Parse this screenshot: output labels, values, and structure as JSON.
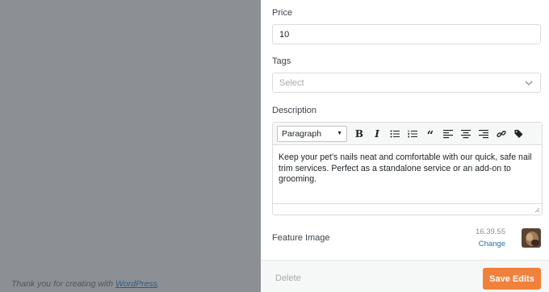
{
  "background": {
    "footer_prefix": "Thank you for creating with ",
    "footer_link": "WordPress",
    "footer_suffix": "."
  },
  "form": {
    "price": {
      "label": "Price",
      "value": "10"
    },
    "tags": {
      "label": "Tags",
      "placeholder": "Select"
    },
    "description": {
      "label": "Description",
      "format": "Paragraph",
      "toolbar_icons": [
        "bold-icon",
        "italic-icon",
        "bullet-list-icon",
        "numbered-list-icon",
        "blockquote-icon",
        "align-left-icon",
        "align-center-icon",
        "align-right-icon",
        "link-icon",
        "tag-icon"
      ],
      "text": "Keep your pet's nails neat and comfortable with our quick, safe nail trim services. Perfect as a standalone service or an add-on to grooming."
    },
    "feature_image": {
      "label": "Feature Image",
      "filename": "16.39.55",
      "change_label": "Change"
    }
  },
  "actions": {
    "delete_label": "Delete",
    "save_label": "Save Edits"
  },
  "colors": {
    "accent": "#f0803c",
    "link": "#2271b1",
    "overlay": "#8c8f94"
  }
}
